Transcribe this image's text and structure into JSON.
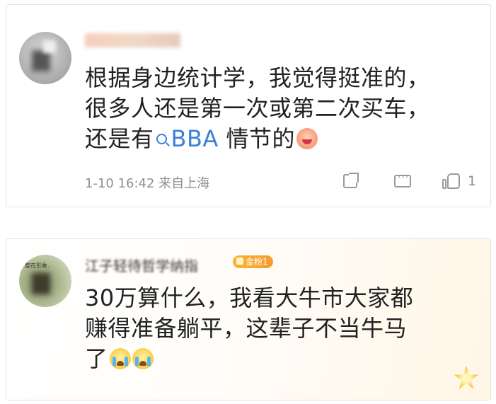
{
  "comments": [
    {
      "avatar_icon": "user-avatar-blurred",
      "username": "",
      "lines": [
        "根据身边统计学，我觉得挺准的，",
        "很多人还是第一次或第二次买车，"
      ],
      "last_line_prefix": "还是有",
      "search_link": "BBA",
      "last_line_suffix": " 情节的",
      "emoji": "laugh-emoji",
      "meta": "1-10 16:42 来自上海",
      "like_count": "1"
    },
    {
      "avatar_icon": "user-avatar-blurred",
      "avatar_text": "整在形象..",
      "username": "江子轻待哲学纳指",
      "badge": "金粉1",
      "lines": [
        "30万算什么，我看大牛市大家都",
        "赚得准备躺平，这辈子不当牛马"
      ],
      "last_line_prefix": "了",
      "emojis": [
        "cry-emoji",
        "cry-emoji"
      ],
      "decoration_icon": "star-badge-icon"
    }
  ]
}
